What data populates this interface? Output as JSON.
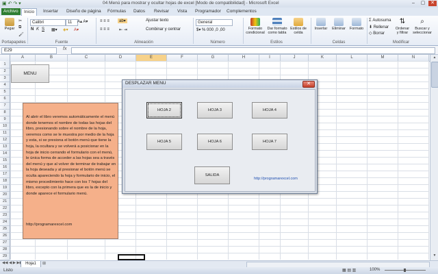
{
  "window": {
    "title": "04 Menú para mostrar y ocultar hojas de excel [Modo de compatibilidad] - Microsoft Excel",
    "controls": [
      "–",
      "▢",
      "✕"
    ]
  },
  "tabs": [
    "Archivo",
    "Inicio",
    "Insertar",
    "Diseño de página",
    "Fórmulas",
    "Datos",
    "Revisar",
    "Vista",
    "Programador",
    "Complementos"
  ],
  "active_tab": "Inicio",
  "ribbon": {
    "paste_label": "Pegar",
    "font_name": "Calibri",
    "font_size": "11",
    "wrap_text": "Ajustar texto",
    "merge_center": "Combinar y centrar",
    "number_format": "General",
    "conditional_format": "Formato condicional",
    "format_table": "Dar formato como tabla",
    "cell_styles": "Estilos de celda",
    "insert": "Insertar",
    "delete": "Eliminar",
    "format": "Formato",
    "autosum": "Autosuma",
    "fill": "Rellenar",
    "clear": "Borrar",
    "sort_filter": "Ordenar y filtrar",
    "find_select": "Buscar y seleccionar",
    "groups": [
      "Portapapeles",
      "Fuente",
      "Alineación",
      "Número",
      "Estilos",
      "Celdas",
      "Modificar"
    ]
  },
  "formula_bar": {
    "name_box": "E29",
    "fx": "fx",
    "formula": ""
  },
  "columns": [
    "A",
    "B",
    "C",
    "D",
    "E",
    "F",
    "G",
    "H",
    "I",
    "J",
    "K",
    "L",
    "M",
    "N"
  ],
  "selected_column": "E",
  "rows": [
    "1",
    "2",
    "3",
    "4",
    "5",
    "6",
    "7",
    "8",
    "9",
    "10",
    "11",
    "12",
    "13",
    "14",
    "15",
    "16",
    "17",
    "18",
    "19",
    "20",
    "21",
    "22",
    "23",
    "24",
    "25",
    "26",
    "27",
    "28",
    "29"
  ],
  "sheet": {
    "menu_button": "MENU",
    "note_text": "Al abrir el libro veremos automáticamente el menú donde tenemos el nombre de todas las hojas del libro, presionando sobre el nombre de la hoja, veremos como se le muestra por medio de la hoja y esta, si se presiona el botón menú que tiene la hoja, la ocultara y se volverá a posicionar en la hoja de inicio cerrando el formulario con el menú, le única forma de acceder a las hojas sea a través del menú y que al volver de terminar de trabajar en la hoja deseada y al presionar el botón menú se oculta apareciendo la hoja y formulario de inicio, el mismo procedimiento hace con los 7 hojas del libro, excepto con la primera que es la de inicio y donde aparece el formulario menú.",
    "note_url": "http://programarexcel.com"
  },
  "dialog": {
    "title": "DESPLAZAR MENU",
    "close": "✕",
    "buttons": [
      "HOJA 2",
      "HOJA 3",
      "HOJA 4",
      "HOJA 5",
      "HOJA 6",
      "HOJA 7"
    ],
    "exit_button": "SALIDA",
    "link": "http://programarexcel.com"
  },
  "sheet_tabs": [
    "Hoja1"
  ],
  "status": {
    "text": "Listo",
    "zoom": "100%"
  }
}
